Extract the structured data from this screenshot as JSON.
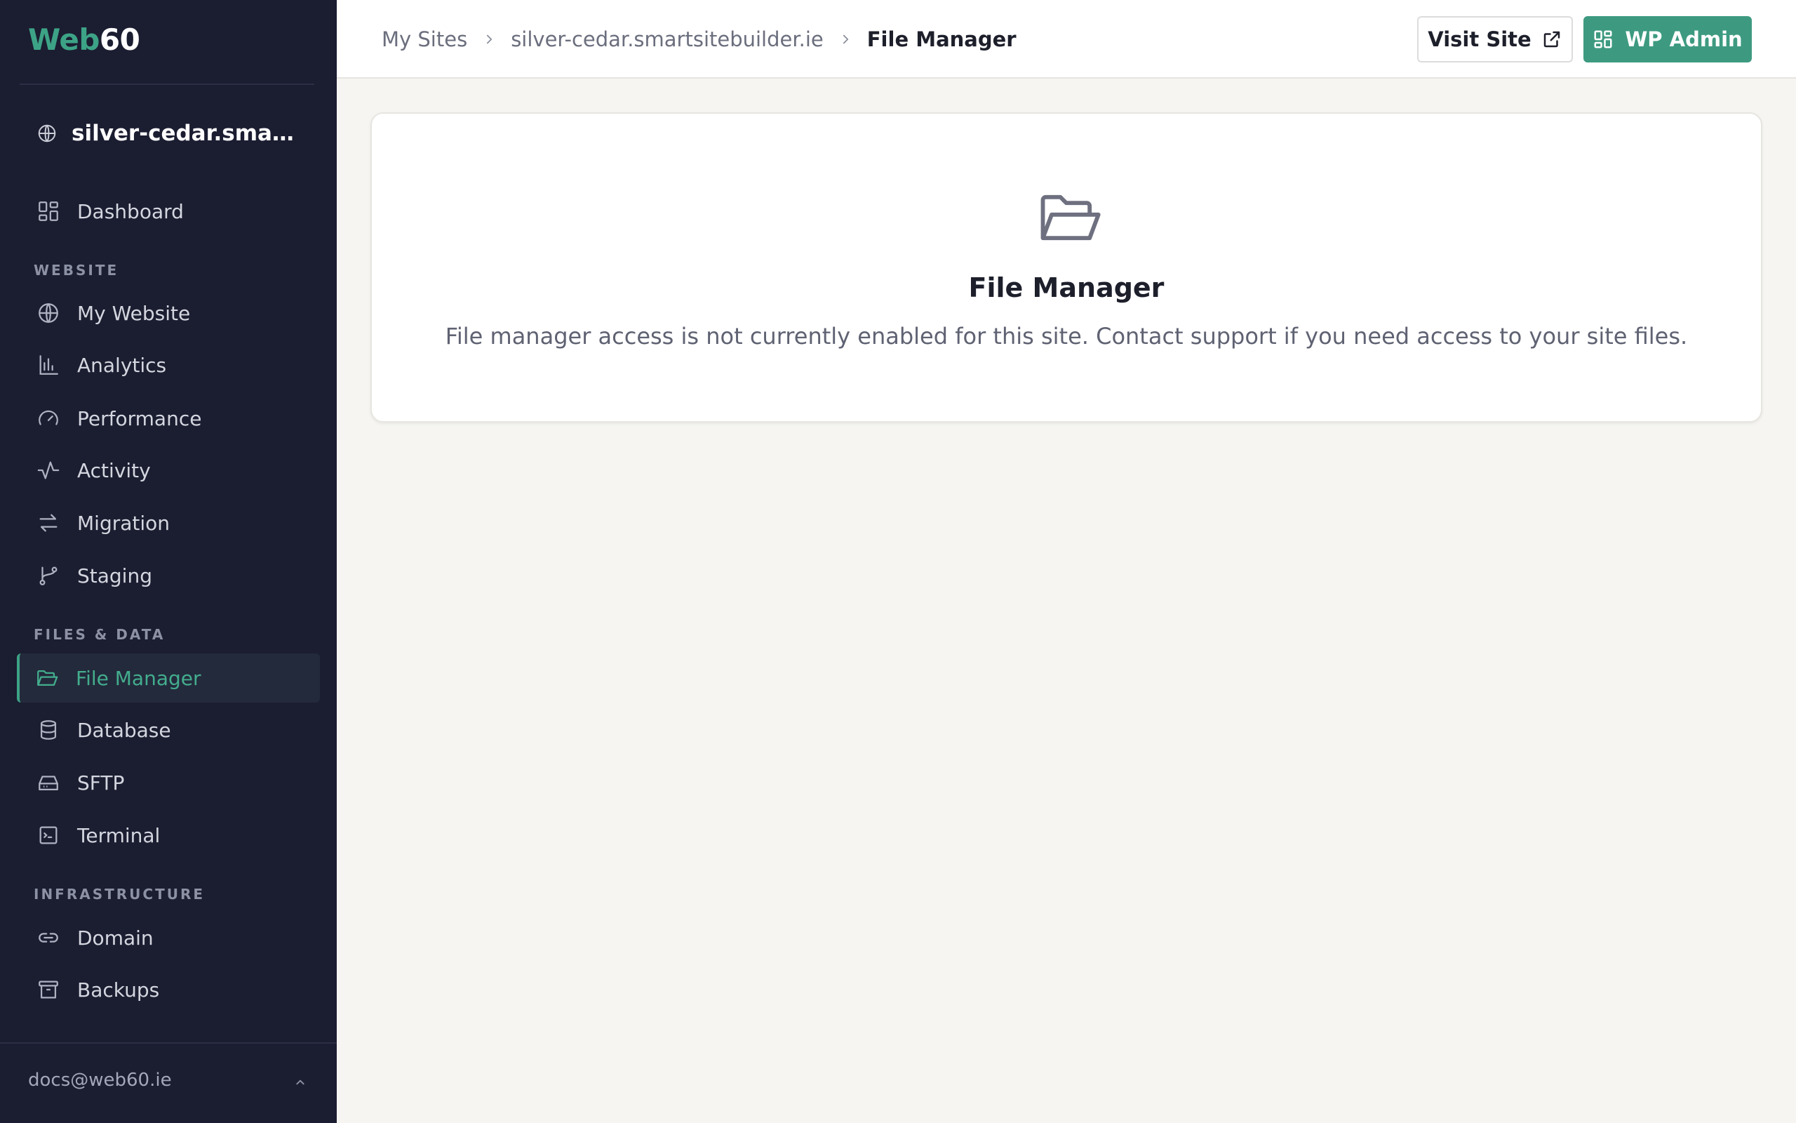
{
  "brand": {
    "part1": "Web",
    "part2": "60"
  },
  "site_selector": {
    "label": "silver-cedar.smartsi…",
    "icon": "globe-icon"
  },
  "sidebar": {
    "dashboard": {
      "label": "Dashboard",
      "icon": "grid-icon"
    },
    "sections": {
      "website": "WEBSITE",
      "files_data": "FILES & DATA",
      "infrastructure": "INFRASTRUCTURE"
    },
    "website_items": [
      {
        "label": "My Website",
        "icon": "globe-icon"
      },
      {
        "label": "Analytics",
        "icon": "bar-chart-icon"
      },
      {
        "label": "Performance",
        "icon": "gauge-icon"
      },
      {
        "label": "Activity",
        "icon": "activity-icon"
      },
      {
        "label": "Migration",
        "icon": "arrows-swap-icon"
      },
      {
        "label": "Staging",
        "icon": "git-branch-icon"
      }
    ],
    "files_items": [
      {
        "label": "File Manager",
        "icon": "folder-open-icon",
        "active": true
      },
      {
        "label": "Database",
        "icon": "database-icon"
      },
      {
        "label": "SFTP",
        "icon": "hard-drive-icon"
      },
      {
        "label": "Terminal",
        "icon": "terminal-icon"
      }
    ],
    "infra_items": [
      {
        "label": "Domain",
        "icon": "link-icon"
      },
      {
        "label": "Backups",
        "icon": "archive-icon"
      }
    ],
    "user_email": "docs@web60.ie"
  },
  "breadcrumb": {
    "items": [
      "My Sites",
      "silver-cedar.smartsitebuilder.ie"
    ],
    "current": "File Manager"
  },
  "header": {
    "visit_site_label": "Visit Site",
    "wp_admin_label": "WP Admin"
  },
  "card": {
    "icon": "folder-open-icon",
    "title": "File Manager",
    "message": "File manager access is not currently enabled for this site. Contact support if you need access to your site files."
  },
  "colors": {
    "sidebar_bg": "#1b1d31",
    "accent": "#3da386",
    "page_bg": "#f6f5f2"
  }
}
